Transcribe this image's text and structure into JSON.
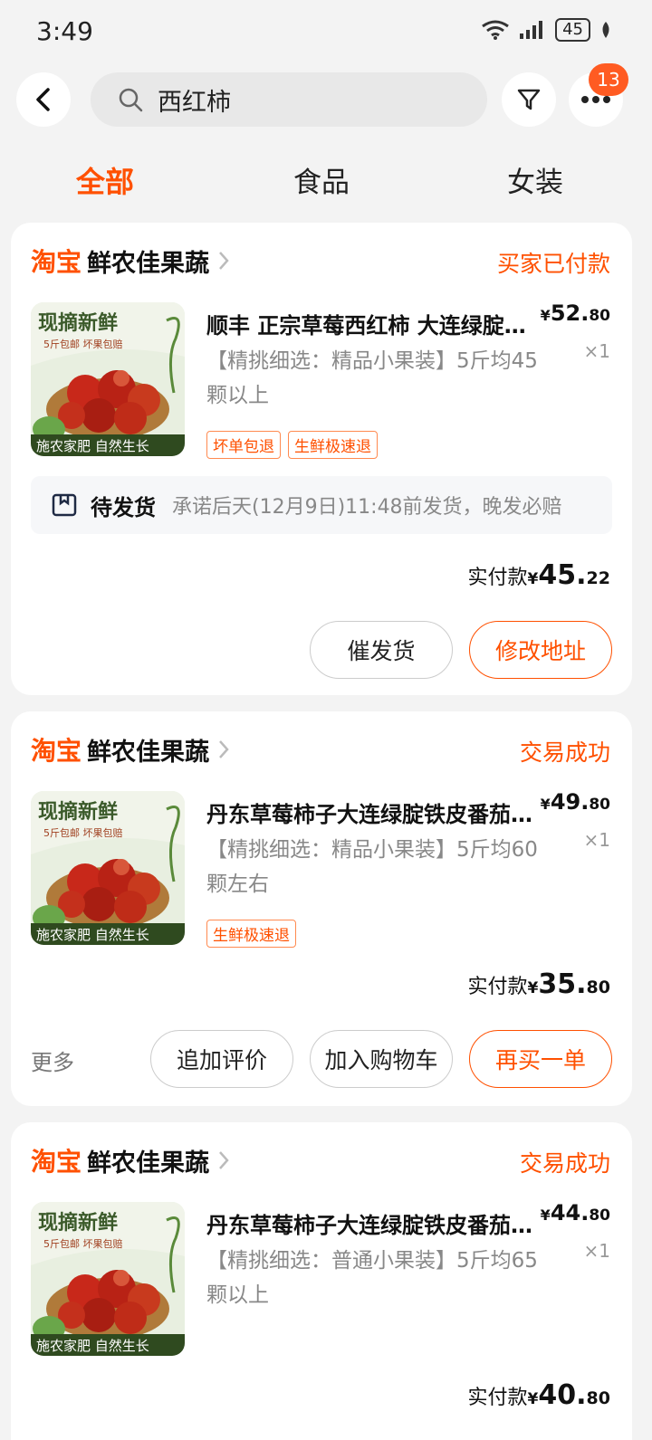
{
  "status_bar": {
    "time": "3:49",
    "battery": "45"
  },
  "search": {
    "query": "西红柿",
    "more_badge": "13"
  },
  "tabs": [
    {
      "label": "全部"
    },
    {
      "label": "食品"
    },
    {
      "label": "女装"
    }
  ],
  "thumb_text": {
    "top": "现摘新鲜",
    "sub": "5斤包邮 坏果包赔",
    "bottom": "施农家肥 自然生长"
  },
  "orders": [
    {
      "logo": "淘宝",
      "shop": "鲜农佳果蔬",
      "status": "买家已付款",
      "title": "顺丰 正宗草莓西红柿 大连绿腚铁皮番茄",
      "spec": "【精挑细选：精品小果装】5斤均45颗以上",
      "price_int": "52.",
      "price_dec": "80",
      "qty": "×1",
      "tags": [
        "坏单包退",
        "生鲜极速退"
      ],
      "ship_state": "待发货",
      "ship_note": "承诺后天(12月9日)11:48前发货，晚发必赔",
      "paid_label": "实付款",
      "paid_int": "45.",
      "paid_dec": "22",
      "buttons": [
        "催发货",
        "修改地址"
      ]
    },
    {
      "logo": "淘宝",
      "shop": "鲜农佳果蔬",
      "status": "交易成功",
      "title": "丹东草莓柿子大连绿腚铁皮番茄新鲜",
      "spec": "【精挑细选：精品小果装】5斤均60颗左右",
      "price_int": "49.",
      "price_dec": "80",
      "qty": "×1",
      "tags": [
        "生鲜极速退"
      ],
      "paid_label": "实付款",
      "paid_int": "35.",
      "paid_dec": "80",
      "more": "更多",
      "buttons": [
        "追加评价",
        "加入购物车",
        "再买一单"
      ]
    },
    {
      "logo": "淘宝",
      "shop": "鲜农佳果蔬",
      "status": "交易成功",
      "title": "丹东草莓柿子大连绿腚铁皮番茄新鲜",
      "spec": "【精挑细选：普通小果装】5斤均65颗以上",
      "price_int": "44.",
      "price_dec": "80",
      "qty": "×1",
      "paid_label": "实付款",
      "paid_int": "40.",
      "paid_dec": "80"
    }
  ],
  "currency": "¥",
  "colors": {
    "accent": "#ff5000",
    "badge": "#ff5b22",
    "background": "#f3f3f3"
  }
}
